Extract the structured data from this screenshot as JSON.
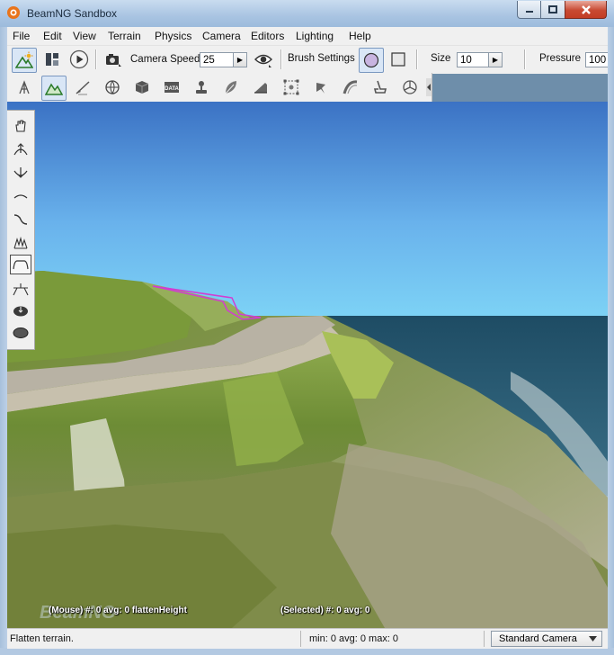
{
  "window": {
    "title": "BeamNG Sandbox"
  },
  "menu": [
    "File",
    "Edit",
    "View",
    "Terrain",
    "Physics",
    "Camera",
    "Editors",
    "Lighting",
    "Help"
  ],
  "toolbar": {
    "camera_speed_label": "Camera Speed",
    "camera_speed_value": "25",
    "brush_settings_label": "Brush Settings",
    "size_label": "Size",
    "size_value": "10",
    "pressure_label": "Pressure",
    "pressure_value": "100"
  },
  "overlay": {
    "mouse_info": "(Mouse) #: 0  avg: 0 flattenHeight",
    "selected_info": "(Selected) #: 0  avg: 0",
    "logo_text": "BeamNG"
  },
  "status": {
    "message": "Flatten terrain.",
    "stats": "min: 0  avg: 0  max: 0",
    "camera_mode": "Standard Camera"
  },
  "colors": {
    "accent_selected": "#d9e6f6",
    "brush_outline": "#d23cd2",
    "sky_top": "#3e76c8",
    "sea": "#2c5a6e"
  }
}
